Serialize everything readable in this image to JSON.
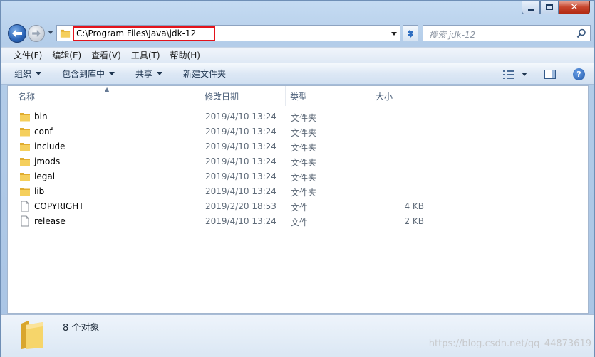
{
  "address": {
    "path": "C:\\Program Files\\Java\\jdk-12"
  },
  "search": {
    "placeholder": "搜索 jdk-12"
  },
  "menu": [
    "文件(F)",
    "编辑(E)",
    "查看(V)",
    "工具(T)",
    "帮助(H)"
  ],
  "toolbar": {
    "organize": "组织",
    "include_library": "包含到库中",
    "share": "共享",
    "new_folder": "新建文件夹"
  },
  "columns": {
    "name": "名称",
    "date": "修改日期",
    "type": "类型",
    "size": "大小"
  },
  "files": [
    {
      "name": "bin",
      "date": "2019/4/10 13:24",
      "type": "文件夹",
      "size": "",
      "icon": "folder-icon"
    },
    {
      "name": "conf",
      "date": "2019/4/10 13:24",
      "type": "文件夹",
      "size": "",
      "icon": "folder-icon"
    },
    {
      "name": "include",
      "date": "2019/4/10 13:24",
      "type": "文件夹",
      "size": "",
      "icon": "folder-icon"
    },
    {
      "name": "jmods",
      "date": "2019/4/10 13:24",
      "type": "文件夹",
      "size": "",
      "icon": "folder-icon"
    },
    {
      "name": "legal",
      "date": "2019/4/10 13:24",
      "type": "文件夹",
      "size": "",
      "icon": "folder-icon"
    },
    {
      "name": "lib",
      "date": "2019/4/10 13:24",
      "type": "文件夹",
      "size": "",
      "icon": "folder-icon"
    },
    {
      "name": "COPYRIGHT",
      "date": "2019/2/20 18:53",
      "type": "文件",
      "size": "4 KB",
      "icon": "file-icon"
    },
    {
      "name": "release",
      "date": "2019/4/10 13:24",
      "type": "文件",
      "size": "2 KB",
      "icon": "file-icon"
    }
  ],
  "status": {
    "count_text": "8 个对象"
  },
  "watermark": "https://blog.csdn.net/qq_44873619",
  "colors": {
    "address_highlight": "#e3131b",
    "folder": "#f1c74e"
  }
}
